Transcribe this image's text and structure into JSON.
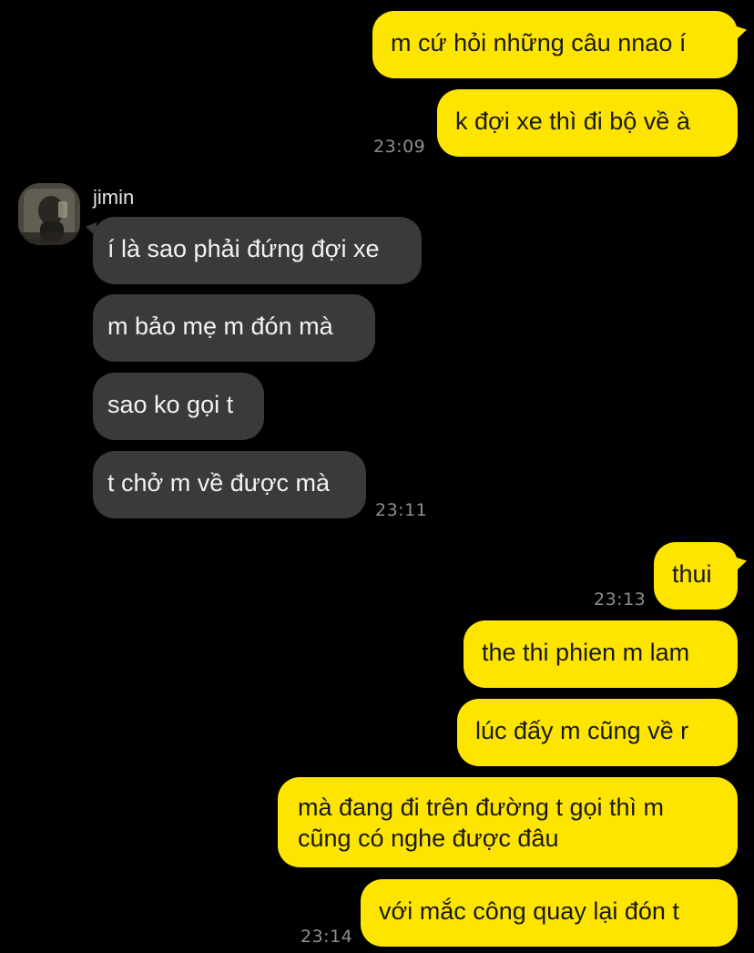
{
  "conversation": {
    "contact": {
      "name": "jimin",
      "avatar_icon": "profile-avatar"
    },
    "messages": [
      {
        "id": "m1",
        "direction": "outgoing",
        "text": "m cứ hỏi những câu nnao í"
      },
      {
        "id": "m2",
        "direction": "outgoing",
        "text": "k đợi xe thì đi bộ về à",
        "time": "23:09"
      },
      {
        "id": "m3",
        "direction": "incoming",
        "text": "í là sao phải đứng đợi xe"
      },
      {
        "id": "m4",
        "direction": "incoming",
        "text": "m bảo mẹ m đón mà"
      },
      {
        "id": "m5",
        "direction": "incoming",
        "text": "sao ko gọi t"
      },
      {
        "id": "m6",
        "direction": "incoming",
        "text": "t chở m về được mà",
        "time": "23:11"
      },
      {
        "id": "m7",
        "direction": "outgoing",
        "text": "thui",
        "time": "23:13"
      },
      {
        "id": "m8",
        "direction": "outgoing",
        "text": "the thi phien m lam"
      },
      {
        "id": "m9",
        "direction": "outgoing",
        "text": "lúc đấy m cũng về r"
      },
      {
        "id": "m10",
        "direction": "outgoing",
        "text": "mà đang đi trên đường t gọi thì m cũng có nghe được đâu"
      },
      {
        "id": "m11",
        "direction": "outgoing",
        "text": "với mắc công quay lại đón t",
        "time": "23:14"
      }
    ]
  },
  "colors": {
    "background": "#000000",
    "outgoing_bubble": "#FEE500",
    "incoming_bubble": "#3A3A3C",
    "timestamp": "#8E8E93"
  }
}
